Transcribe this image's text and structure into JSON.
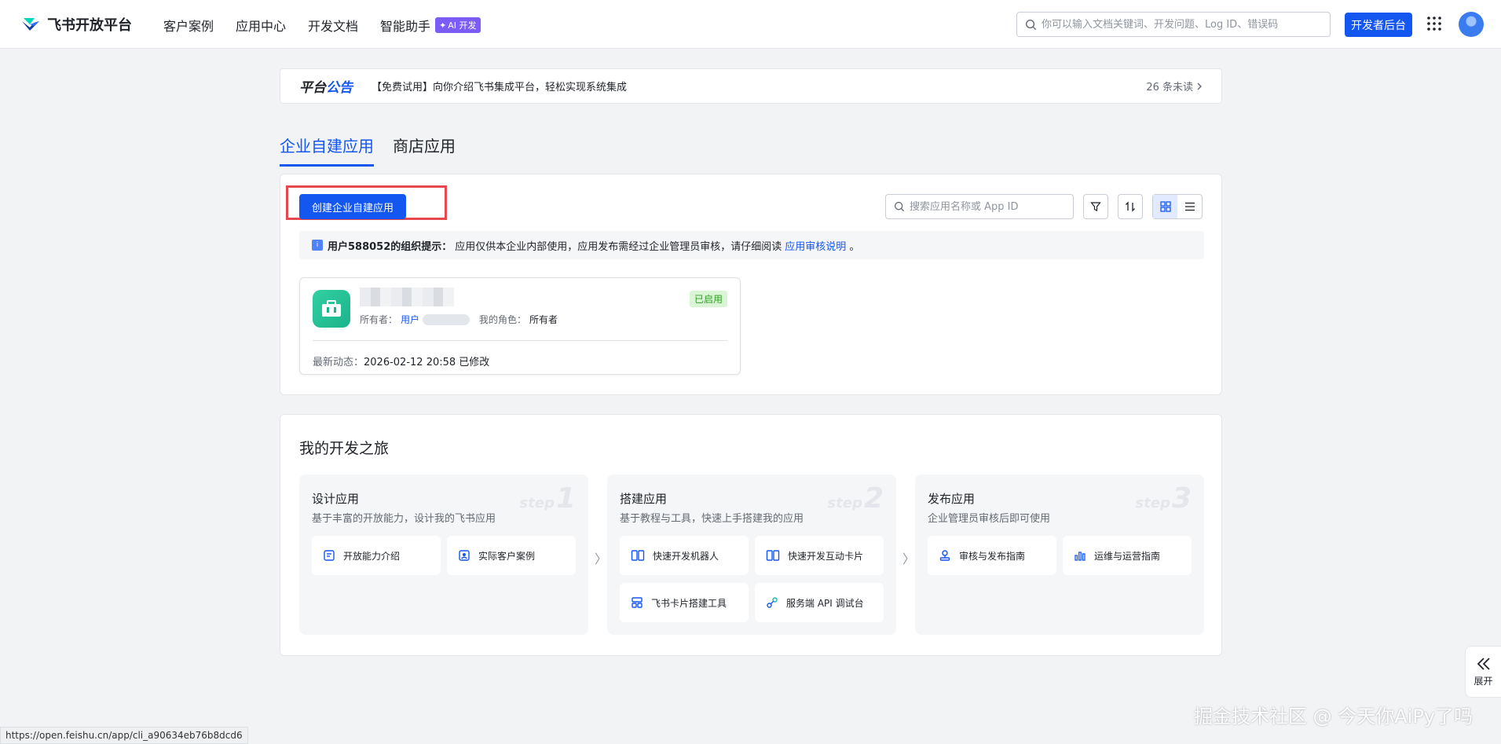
{
  "topbar": {
    "brand": "飞书开放平台",
    "nav": [
      "客户案例",
      "应用中心",
      "开发文档",
      "智能助手"
    ],
    "ai_badge": "AI 开发",
    "search_placeholder": "你可以输入文档关键词、开发问题、Log ID、错误码",
    "dev_button": "开发者后台"
  },
  "announcement": {
    "label_a": "平台",
    "label_b": "公告",
    "text": "【免费试用】向你介绍飞书集成平台，轻松实现系统集成",
    "unread": "26 条未读"
  },
  "tabs": [
    {
      "label": "企业自建应用",
      "active": true
    },
    {
      "label": "商店应用",
      "active": false
    }
  ],
  "apps": {
    "create_button": "创建企业自建应用",
    "search_placeholder": "搜索应用名称或 App ID",
    "notice_org": "用户588052的组织提示：",
    "notice_text": "应用仅供本企业内部使用，应用发布需经过企业管理员审核，请仔细阅读",
    "notice_link": "应用审核说明",
    "notice_end": "。",
    "card": {
      "owner_label": "所有者：",
      "owner_value": "用户",
      "role_label": "我的角色：",
      "role_value": "所有者",
      "status": "已启用",
      "recent_label": "最新动态：",
      "recent_value": "2026-02-12 20:58 已修改"
    }
  },
  "journey": {
    "title": "我的开发之旅",
    "step_word": "step",
    "steps": [
      {
        "num": "1",
        "title": "设计应用",
        "desc": "基于丰富的开放能力，设计我的飞书应用",
        "items": [
          "开放能力介绍",
          "实际客户案例"
        ]
      },
      {
        "num": "2",
        "title": "搭建应用",
        "desc": "基于教程与工具，快速上手搭建我的应用",
        "items": [
          "快速开发机器人",
          "快速开发互动卡片",
          "飞书卡片搭建工具",
          "服务端 API 调试台"
        ]
      },
      {
        "num": "3",
        "title": "发布应用",
        "desc": "企业管理员审核后即可使用",
        "items": [
          "审核与发布指南",
          "运维与运营指南"
        ]
      }
    ]
  },
  "side_expand": "展开",
  "status_url": "https://open.feishu.cn/app/cli_a90634eb76b8dcd6",
  "watermark": "掘金技术社区 @ 今天你AiPy了吗",
  "colors": {
    "primary": "#1456f0",
    "highlight": "#e5484d",
    "success": "#2ea121",
    "ai": "#7b5cf6"
  }
}
